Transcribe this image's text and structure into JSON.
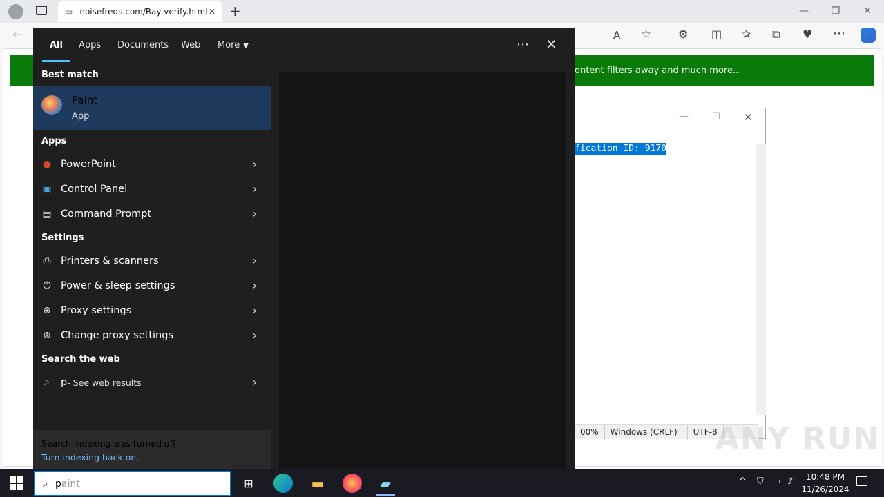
{
  "browser": {
    "tab_title": "noisefreqs.com/Ray-verify.html",
    "banner_text": "ontent filters away and much more..."
  },
  "notepad": {
    "selected_text": "fication ID: 9170",
    "status": {
      "zoom": "00%",
      "line_ending": "Windows (CRLF)",
      "encoding": "UTF-8"
    }
  },
  "search_panel": {
    "tabs": [
      "All",
      "Apps",
      "Documents",
      "Web",
      "More"
    ],
    "best_match_heading": "Best match",
    "best_match": {
      "title": "Paint",
      "subtitle": "App"
    },
    "apps_heading": "Apps",
    "apps": [
      "PowerPoint",
      "Control Panel",
      "Command Prompt"
    ],
    "settings_heading": "Settings",
    "settings": [
      "Printers & scanners",
      "Power & sleep settings",
      "Proxy settings",
      "Change proxy settings"
    ],
    "web_heading": "Search the web",
    "web_query": "p",
    "web_suffix": " - See web results",
    "indexing_msg": "Search indexing was turned off.",
    "indexing_link": "Turn indexing back on."
  },
  "taskbar": {
    "search_value": "p",
    "search_placeholder_rest": "aint",
    "time": "10:48 PM",
    "date": "11/26/2024"
  },
  "watermark": "ANY RUN",
  "colors": {
    "accent": "#0078d7",
    "panel_bg": "#1f1f1f",
    "best_match_bg": "#1e3a5c",
    "banner": "#0a7b0a"
  }
}
